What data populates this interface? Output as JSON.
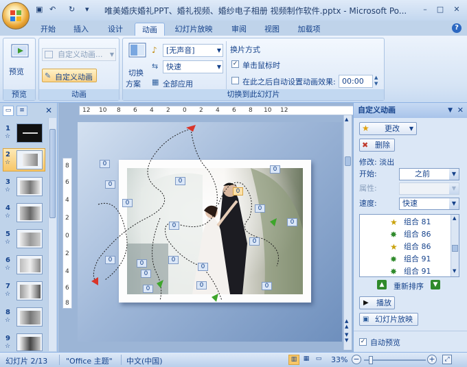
{
  "window": {
    "title": "唯美婚庆婚礼PPT、婚礼视频、婚纱电子相册 视频制作软件.pptx - Microsoft Po...",
    "minimize_glyph": "–",
    "maximize_glyph": "□",
    "close_glyph": "✕"
  },
  "quick_access": {
    "save_glyph": "▣",
    "undo_glyph": "↶",
    "redo_glyph": "↻",
    "customize_glyph": "▾"
  },
  "tabs": [
    {
      "label": "开始"
    },
    {
      "label": "插入"
    },
    {
      "label": "设计"
    },
    {
      "label": "动画"
    },
    {
      "label": "幻灯片放映"
    },
    {
      "label": "审阅"
    },
    {
      "label": "视图"
    },
    {
      "label": "加载项"
    }
  ],
  "help_glyph": "?",
  "ribbon": {
    "preview_group": {
      "label": "预览",
      "preview_button": "预览"
    },
    "animation_group": {
      "label": "动画",
      "custom_animation_dropdown": "自定义动画...",
      "custom_animation_button": "自定义动画"
    },
    "transition_group": {
      "label": "切换到此幻灯片",
      "transition_scheme_line1": "切换",
      "transition_scheme_line2": "方案",
      "sound_value": "[无声音]",
      "speed_value": "快速",
      "apply_all_label": "全部应用",
      "advance_heading": "换片方式",
      "on_click_label": "单击鼠标时",
      "on_click_checked": true,
      "auto_after_label": "在此之后自动设置动画效果:",
      "auto_after_checked": false,
      "auto_after_value": "00:00"
    }
  },
  "slides": [
    {
      "number": "1",
      "star": "☆"
    },
    {
      "number": "2",
      "star": "☆"
    },
    {
      "number": "3",
      "star": "☆"
    },
    {
      "number": "4",
      "star": "☆"
    },
    {
      "number": "5",
      "star": "☆"
    },
    {
      "number": "6",
      "star": "☆"
    },
    {
      "number": "7",
      "star": "☆"
    },
    {
      "number": "8",
      "star": "☆"
    },
    {
      "number": "9",
      "star": "☆"
    }
  ],
  "ruler": {
    "horizontal": [
      "12",
      "10",
      "8",
      "6",
      "4",
      "2",
      "0",
      "2",
      "4",
      "6",
      "8",
      "10",
      "12"
    ],
    "vertical": [
      "8",
      "6",
      "4",
      "2",
      "0",
      "2",
      "4",
      "6",
      "8"
    ]
  },
  "slide_tags": [
    "0",
    "0",
    "0",
    "0",
    "0",
    "0",
    "0",
    "0",
    "0",
    "0",
    "0",
    "0",
    "0",
    "0",
    "0",
    "0",
    "0",
    "0"
  ],
  "task_pane": {
    "title": "自定义动画",
    "close_glyph": "✕",
    "menu_glyph": "▼",
    "change_button": "更改",
    "remove_button": "删除",
    "modify_label": "修改: 淡出",
    "start_label": "开始:",
    "start_value": "之前",
    "property_label": "属性:",
    "property_value": "",
    "speed_label": "速度:",
    "speed_value": "快速",
    "effects": [
      {
        "label": "组合 81"
      },
      {
        "label": "组合 86"
      },
      {
        "label": "组合 86"
      },
      {
        "label": "组合 91"
      },
      {
        "label": "组合 91"
      }
    ],
    "reorder_label": "重新排序",
    "play_button": "播放",
    "slideshow_button": "幻灯片放映",
    "autopreview_label": "自动预览",
    "autopreview_checked": true
  },
  "status": {
    "slide_info": "幻灯片 2/13",
    "theme": "\"Office 主题\"",
    "language": "中文(中国)",
    "zoom": "33%",
    "zoom_level_fraction": 0.33
  },
  "colors": {
    "accent": "#15428b",
    "ribbon_bg": "#dbe7f7",
    "selected": "#fbd48a"
  }
}
